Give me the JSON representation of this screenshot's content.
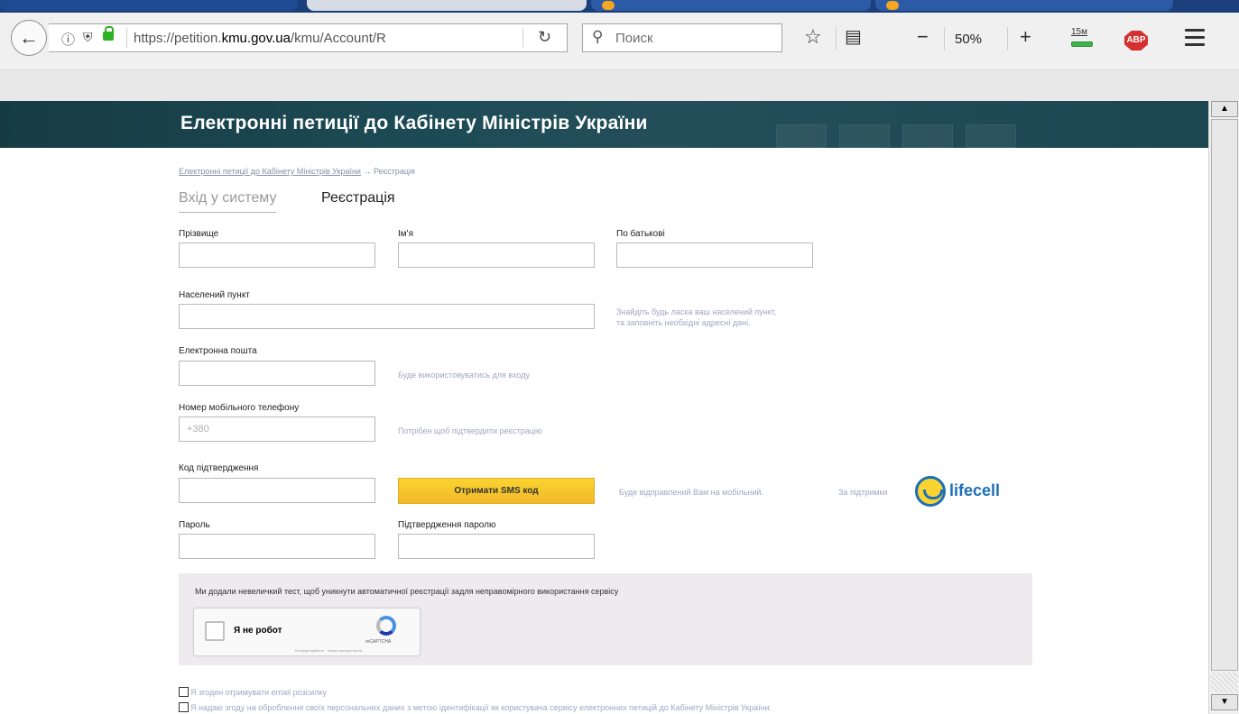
{
  "browser": {
    "url_prefix": "https://petition.",
    "url_domain": "kmu.gov.ua",
    "url_path": "/kmu/Account/R",
    "search_placeholder": "Поиск",
    "zoom": "50%",
    "downloads_label": "15м",
    "abp_label": "ABP"
  },
  "header": {
    "title": "Електронні петиції до Кабінету Міністрів України"
  },
  "breadcrumb": {
    "home": "Електронні петиції до Кабінету Міністрів України",
    "arrow": "→",
    "current": "Реєстрація"
  },
  "tabs": {
    "login": "Вхід у систему",
    "register": "Реєстрація"
  },
  "form": {
    "surname_label": "Прізвище",
    "name_label": "Ім'я",
    "patronymic_label": "По батькові",
    "locality_label": "Населений пункт",
    "locality_hint_1": "Знайдіть будь ласка ваш населений пункт,",
    "locality_hint_2": "та заповніть необхідні адресні дані.",
    "email_label": "Електронна пошта",
    "email_hint": "Буде використовуватись для входу",
    "phone_label": "Номер мобільного телефону",
    "phone_placeholder": "+380",
    "phone_hint": "Потрібен щоб підтвердити реєстрацію",
    "code_label": "Код підтвердження",
    "sms_button": "Отримати SMS код",
    "sms_hint": "Буде відправлений Вам на мобільний.",
    "support_label": "За підтримки",
    "lifecell": "lifecell",
    "password_label": "Пароль",
    "password_confirm_label": "Підтвердження паролю"
  },
  "captcha": {
    "intro": "Ми додали невеличкий тест, щоб уникнути автоматичної реєстрації задля неправомірного використання сервісу",
    "robot_label": "Я не робот",
    "brand": "reCAPTCHA",
    "terms": "Конфіденційність - Умови використання"
  },
  "consents": {
    "newsletter": "Я згоден отримувати email розсилку",
    "personal_data": "Я надаю згоду на оброблення своїх персональних даних з метою ідентифікації як користувача сервісу електронних петицій до Кабінету Міністрів України."
  }
}
